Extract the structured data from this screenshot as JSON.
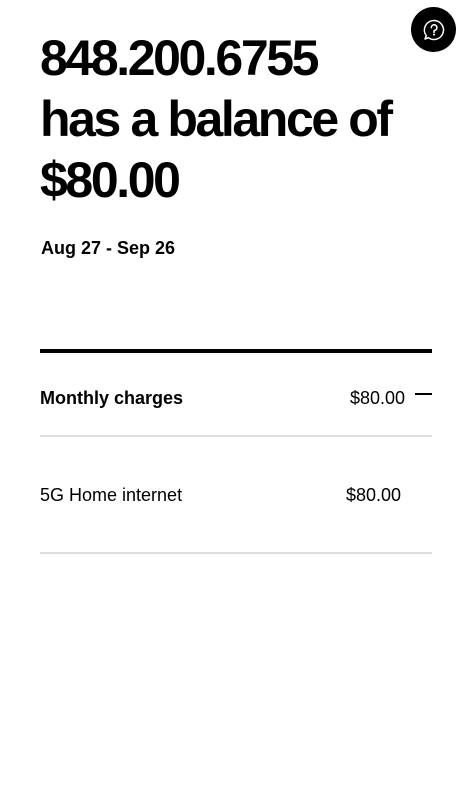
{
  "header": {
    "help_icon": "question-mark-chat-bubble-icon",
    "headline_lines": [
      "848.200.6755",
      "has a balance of",
      "$80.00"
    ],
    "date_range": "Aug 27 - Sep 26"
  },
  "charges": {
    "summary": {
      "label": "Monthly charges",
      "amount": "$80.00",
      "toggle_icon": "minus-collapse-icon"
    },
    "items": [
      {
        "label": "5G Home internet",
        "amount": "$80.00"
      }
    ]
  }
}
